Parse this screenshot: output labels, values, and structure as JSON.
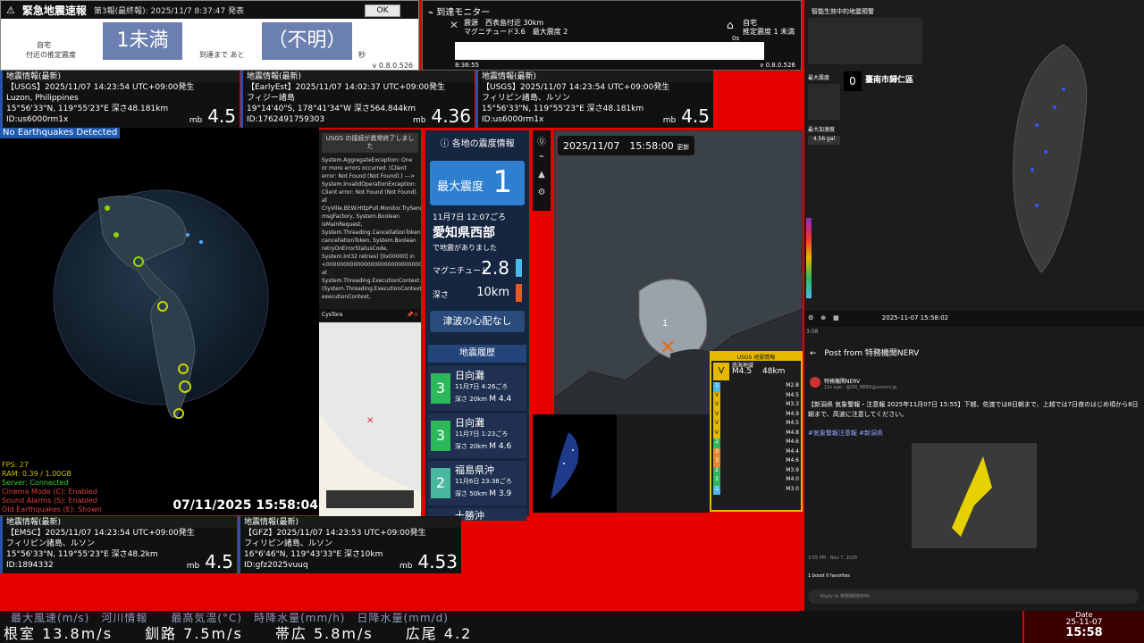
{
  "eew": {
    "title": "緊急地震速報",
    "report": "第3報(最終報): 2025/11/7 8:37:47 発表",
    "ok": "OK",
    "location_label1": "自宅",
    "location_label2": "付近の推定震度",
    "intensity": "1未満",
    "until_label": "到達まで あと",
    "until_value": "（不明）",
    "unit": "秒",
    "version": "v 0.8.0.526"
  },
  "arrival": {
    "title": "到達モニター",
    "line1": "震源　西表島付近 30km",
    "line2": "マグニチュード3.6　最大震度 2",
    "home": "自宅",
    "home_int": "推定震度 1 未満",
    "zero": "0s",
    "time": "8:36:55",
    "version": "v 0.8.0.526"
  },
  "cards_top": [
    {
      "header": "地震情報(最新)",
      "line1": "【USGS】2025/11/07 14:23:54 UTC+09:00発生",
      "line2": "Luzon, Philippines",
      "line3": "15°56'33\"N, 119°55'23\"E 深さ48.181km",
      "id": "ID:us6000rm1x",
      "mb": "mb",
      "mag": "4.5"
    },
    {
      "header": "地震情報(最新)",
      "line1": "【EarlyEst】2025/11/07 14:02:37 UTC+09:00発生",
      "line2": "フィジー諸島",
      "line3": "19°14'40\"S, 178°41'34\"W 深さ564.844km",
      "id": "ID:1762491759303",
      "mb": "mb",
      "mag": "4.36"
    },
    {
      "header": "地震情報(最新)",
      "line1": "【USGS】2025/11/07 14:23:54 UTC+09:00発生",
      "line2": "フィリピン諸島、ルソン",
      "line3": "15°56'33\"N, 119°55'23\"E 深さ48.181km",
      "id": "ID:us6000rm1x",
      "mb": "mb",
      "mag": "4.5"
    }
  ],
  "cards_bottom": [
    {
      "header": "地震情報(最新)",
      "line1": "【EMSC】2025/11/07 14:23:54 UTC+09:00発生",
      "line2": "フィリピン諸島、ルソン",
      "line3": "15°56'33\"N, 119°55'23\"E 深さ48.2km",
      "id": "ID:1894332",
      "mb": "mb",
      "mag": "4.5"
    },
    {
      "header": "地震情報(最新)",
      "line1": "【GFZ】2025/11/07 14:23:53 UTC+09:00発生",
      "line2": "フィリピン諸島、ルソン",
      "line3": "16°6'46\"N, 119°43'33\"E 深さ10km",
      "id": "ID:gfz2025vuuq",
      "mb": "mb",
      "mag": "4.53"
    }
  ],
  "globe": {
    "no_eq": "No Earthquakes Detected",
    "stats": [
      "FPS: 27",
      "RAM: 0.39 / 1.00GB",
      "Server: Connected",
      "Cinema Mode (C): Enabled",
      "Sound Alarms (S): Enabled",
      "Old Earthquakes (E): Shown"
    ],
    "clock": "07/11/2025 15:58:04"
  },
  "error_panel": {
    "title": "USGS の接続が異常終了しました",
    "text": "System.AggregateException: One or more errors occurred. (Client error: Not Found (Not Found).) ---> System.InvalidOperationException: Client error: Not Found (Not Found). at CryVille.BEW.HttpPull.Monitor.TrySendAsync[System.Func`1[TResult] msgFactory, System.Boolean isMainRequest, System.Threading.CancellationToken cancellationToken, System.Boolean retryOnErrorStatusCode, System.Int32 retries) [0x00000] in <000000000000000000000000000000000>:0 at System.Threading.ExecutionContext.RunInternal (System.Threading.ExecutionContext executionContext,",
    "footer": "CysTora"
  },
  "info": {
    "title": "各地の震度情報",
    "max_label": "最大震度",
    "max_value": "1",
    "date": "11月7日 12:07ごろ",
    "place": "愛知県西部",
    "note": "で地震がありました",
    "mag_label": "マグニチュード",
    "mag_value": "2.8",
    "depth_label": "深さ",
    "depth_value": "10km",
    "tsunami": "津波の心配なし",
    "history_title": "地震履歴",
    "history": [
      {
        "int": "3",
        "place": "日向灘",
        "date": "11月7日 4:26ごろ",
        "depth": "深さ",
        "depth_v": "20km",
        "mag": "M 4.4"
      },
      {
        "int": "3",
        "place": "日向灘",
        "date": "11月7日 1:23ごろ",
        "depth": "深さ",
        "depth_v": "20km",
        "mag": "M 4.6"
      },
      {
        "int": "2",
        "place": "福島県沖",
        "date": "11月6日 23:38ごろ",
        "depth": "深さ",
        "depth_v": "50km",
        "mag": "M 3.9"
      },
      {
        "int": "",
        "place": "十勝沖",
        "date": "",
        "depth": "",
        "depth_v": "",
        "mag": ""
      }
    ]
  },
  "map": {
    "time": "2025/11/07　15:58:00",
    "update": "更新",
    "pin": "1"
  },
  "usgs": {
    "title": "USGS 地震情報",
    "level": "V",
    "region": "南海地域",
    "mag": "M4.5",
    "depth": "48km",
    "rows": [
      {
        "n": "1",
        "m": "M2.8"
      },
      {
        "n": "V",
        "m": "M4.5"
      },
      {
        "n": "V",
        "m": "M3.3"
      },
      {
        "n": "V",
        "m": "M4.9"
      },
      {
        "n": "V",
        "m": "M4.5"
      },
      {
        "n": "V",
        "m": "M4.8"
      },
      {
        "n": "2",
        "m": "M4.6"
      },
      {
        "n": "3",
        "m": "M4.4"
      },
      {
        "n": "3",
        "m": "M4.6"
      },
      {
        "n": "2",
        "m": "M3.9"
      },
      {
        "n": "2",
        "m": "M4.0"
      },
      {
        "n": "1",
        "m": "M3.0"
      }
    ]
  },
  "taiwan": {
    "title": "智能生效中的地震預警",
    "max_int_label": "最大震度",
    "max_int": "0",
    "station": "臺南市歸仁區",
    "pga_label": "最大加速度",
    "pga": "4.56 gal",
    "datetime": "2025-11-07 15:58:02"
  },
  "tweet": {
    "header": "Post from 特務機関NERV",
    "name": "特務機関NERV",
    "handle": "12s ago · @UN_NERV@unnerv.jp",
    "body": "【新潟県 気象警報・注意報 2025年11月07日 15:55】下越、佐渡では8日朝まで、上越では7日夜のはじめ頃から8日朝まで、高波に注意してください。",
    "tags": "#気象警報注意報 #新潟県",
    "time": "3:55 PM · Nov 7, 2025",
    "stats": "1 boost 0 favorites",
    "reply": "Reply to 特務機関NERV",
    "clock": "3:58"
  },
  "ticker": {
    "row1": "最大風速(m/s)　河川情報　　最高気温(°C)　時降水量(mm/h)　日降水量(mm/d)",
    "row2": "根室 13.8m/s　　釧路 7.5m/s　　帯広 5.8m/s　　広尾 4.2",
    "date_label": "Date",
    "date": "25-11-07",
    "time": "15:58"
  },
  "colors": {
    "accent": "#2a52a8",
    "alert_red": "#e50000",
    "usgs_gold": "#e6b800"
  }
}
